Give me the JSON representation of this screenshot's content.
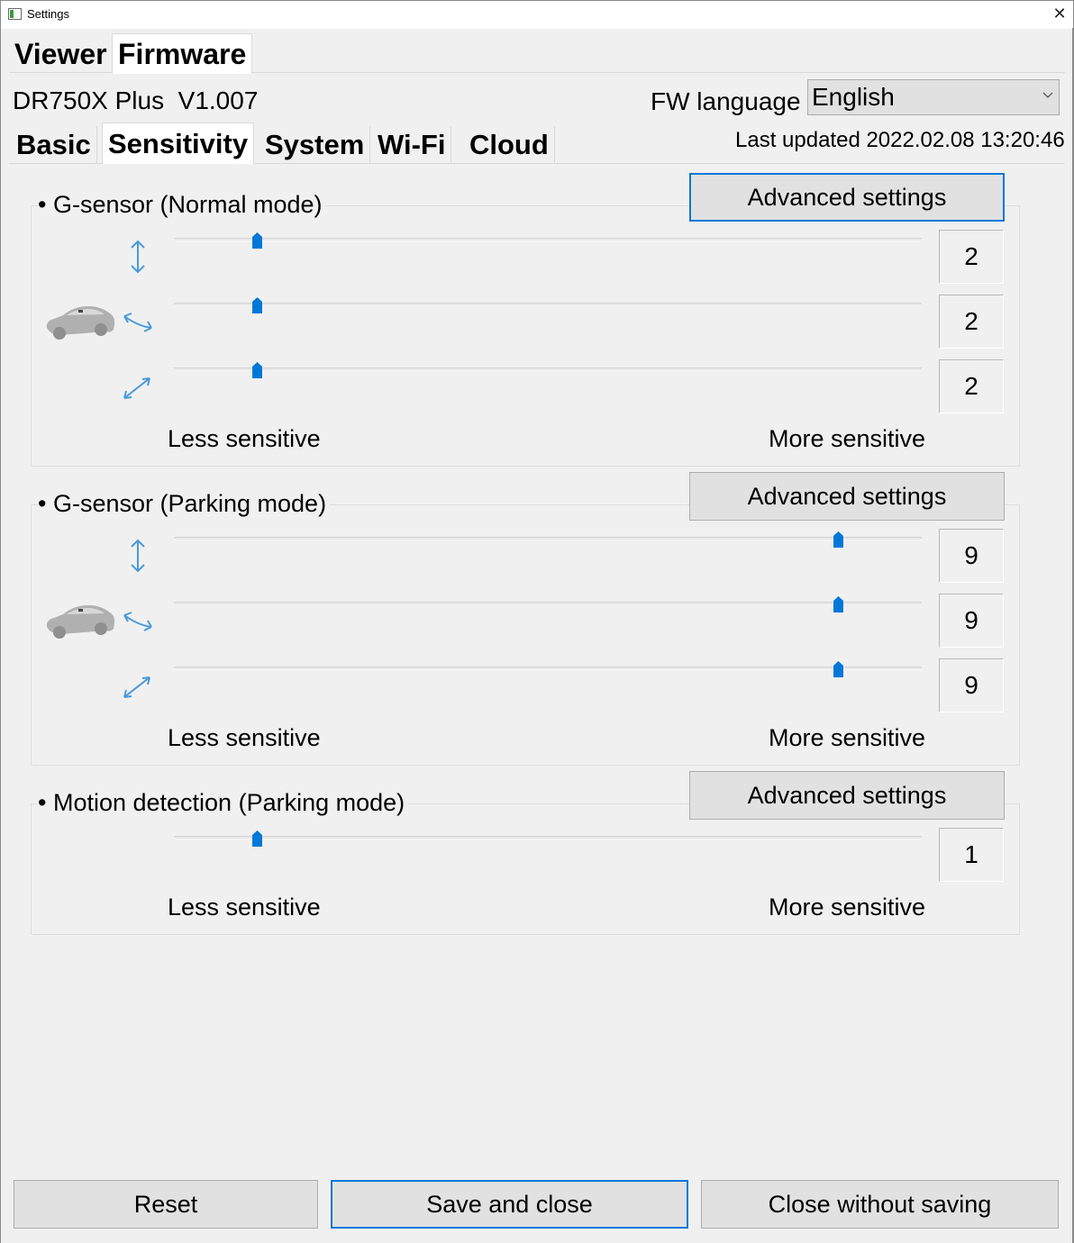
{
  "window": {
    "title": "Settings",
    "close_glyph": "✕"
  },
  "top_tabs": [
    {
      "label": "Viewer",
      "selected": false
    },
    {
      "label": "Firmware",
      "selected": true
    }
  ],
  "device": {
    "model_version": "DR750X Plus  V1.007"
  },
  "fw_language": {
    "label": "FW language",
    "value": "English",
    "chevron_icon": "chevron-down-icon"
  },
  "sub_tabs": [
    {
      "label": "Basic",
      "selected": false
    },
    {
      "label": "Sensitivity",
      "selected": true
    },
    {
      "label": "System",
      "selected": false
    },
    {
      "label": "Wi-Fi",
      "selected": false
    },
    {
      "label": "Cloud",
      "selected": false
    }
  ],
  "last_updated": "Last updated 2022.02.08 13:20:46",
  "sliders": {
    "min": 1,
    "max": 10
  },
  "groups": [
    {
      "title": "• G-sensor (Normal mode)",
      "advanced_label": "Advanced settings",
      "rows": [
        {
          "axis_icon": "vertical-arrow-icon",
          "value": 2,
          "display": "2"
        },
        {
          "axis_icon": "horizontal-arrow-icon",
          "value": 2,
          "display": "2"
        },
        {
          "axis_icon": "diagonal-arrow-icon",
          "value": 2,
          "display": "2"
        }
      ],
      "less_label": "Less sensitive",
      "more_label": "More sensitive"
    },
    {
      "title": "• G-sensor (Parking mode)",
      "advanced_label": "Advanced settings",
      "rows": [
        {
          "axis_icon": "vertical-arrow-icon",
          "value": 9,
          "display": "9"
        },
        {
          "axis_icon": "horizontal-arrow-icon",
          "value": 9,
          "display": "9"
        },
        {
          "axis_icon": "diagonal-arrow-icon",
          "value": 9,
          "display": "9"
        }
      ],
      "less_label": "Less sensitive",
      "more_label": "More sensitive"
    },
    {
      "title": "• Motion detection (Parking mode)",
      "advanced_label": "Advanced settings",
      "rows": [
        {
          "value": 2,
          "display": "1"
        }
      ],
      "less_label": "Less sensitive",
      "more_label": "More sensitive"
    }
  ],
  "buttons": {
    "reset": "Reset",
    "save": "Save and close",
    "close": "Close without saving"
  },
  "colors": {
    "accent": "#0078d7",
    "icon_blue": "#4a9ad8",
    "car_gray": "#a8a8a8"
  }
}
